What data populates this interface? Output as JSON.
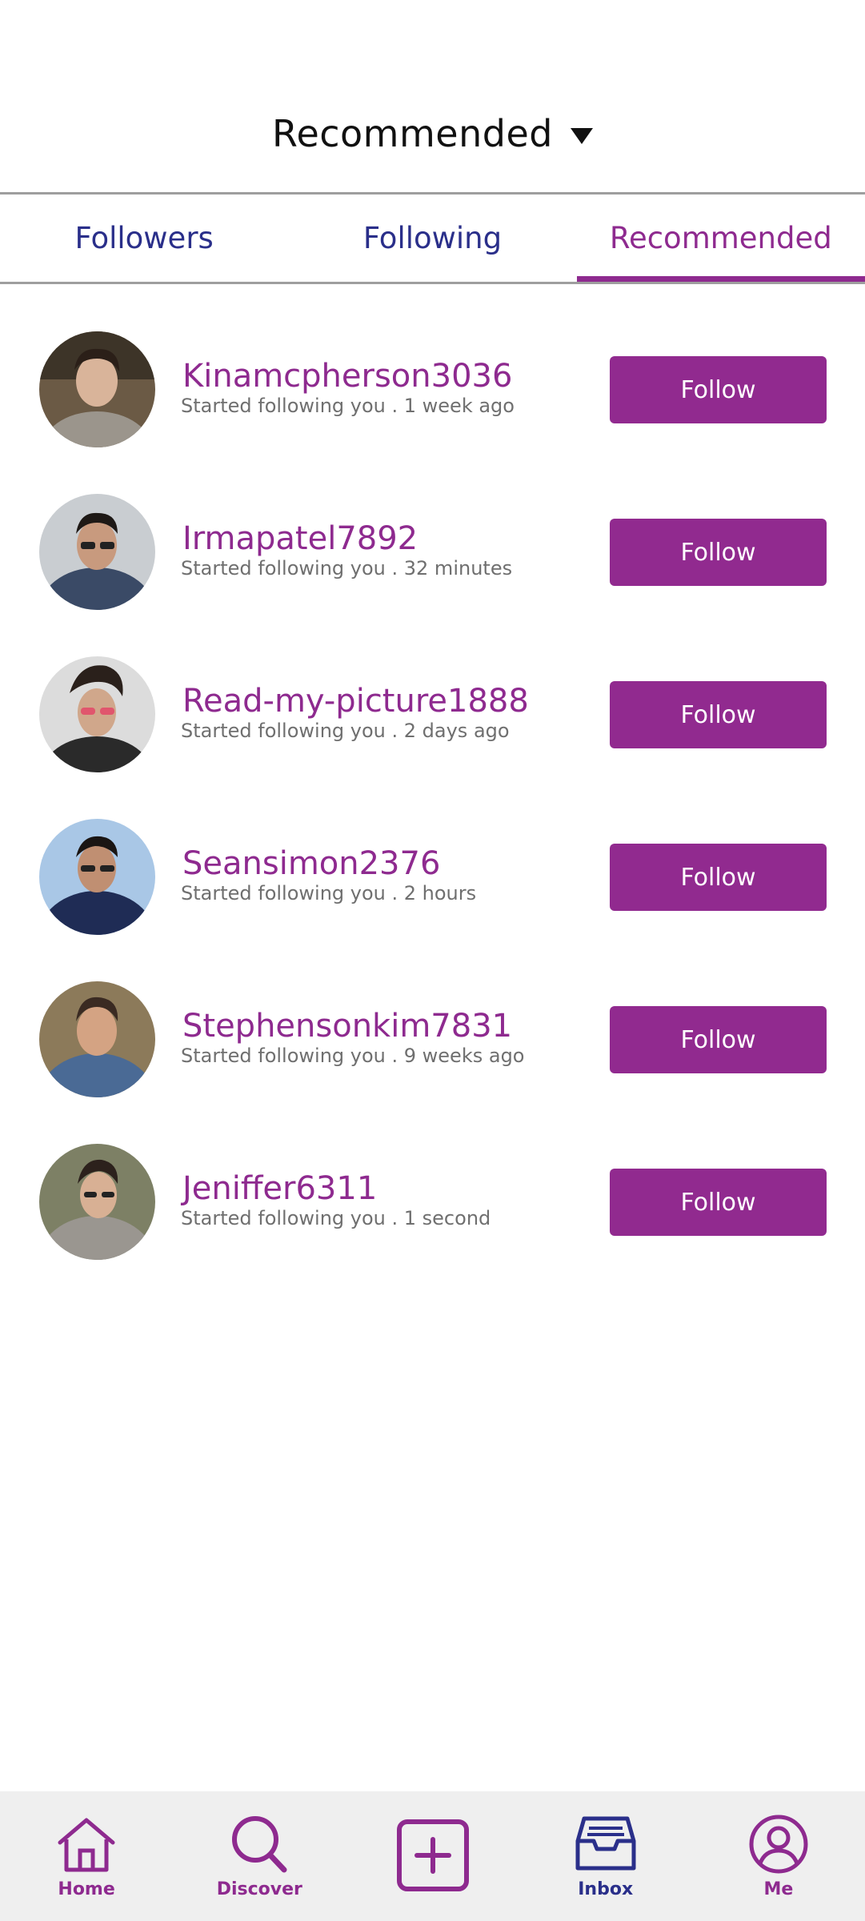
{
  "header": {
    "title": "Recommended"
  },
  "tabs": [
    {
      "label": "Followers",
      "active": false
    },
    {
      "label": "Following",
      "active": false
    },
    {
      "label": "Recommended",
      "active": true
    }
  ],
  "users": [
    {
      "name": "Kinamcpherson3036",
      "subtitle": "Started following you . 1 week ago",
      "button": "Follow"
    },
    {
      "name": "Irmapatel7892",
      "subtitle": "Started following you . 32 minutes",
      "button": "Follow"
    },
    {
      "name": "Read-my-picture1888",
      "subtitle": "Started following you . 2 days ago",
      "button": "Follow"
    },
    {
      "name": "Seansimon2376",
      "subtitle": "Started following you . 2 hours",
      "button": "Follow"
    },
    {
      "name": "Stephensonkim7831",
      "subtitle": "Started following you . 9 weeks ago",
      "button": "Follow"
    },
    {
      "name": "Jeniffer6311",
      "subtitle": "Started following you . 1 second",
      "button": "Follow"
    }
  ],
  "nav": {
    "home": "Home",
    "discover": "Discover",
    "inbox": "Inbox",
    "me": "Me"
  },
  "colors": {
    "accent": "#8e2a8f",
    "tab_text": "#2a2f8a",
    "button_bg": "#912a8f",
    "nav_bg": "#efefef"
  }
}
